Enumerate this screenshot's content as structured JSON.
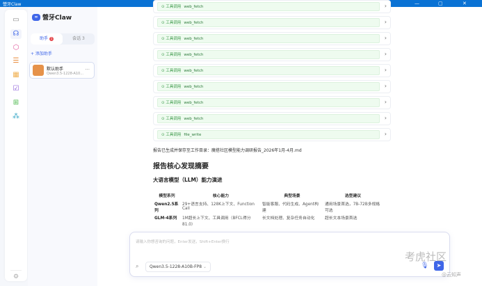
{
  "window": {
    "title": "營牙Claw",
    "minimize": "—",
    "maximize": "▢",
    "close": "✕"
  },
  "app": {
    "name": "營牙Claw",
    "logo": "∞"
  },
  "panel": {
    "tabs": [
      {
        "label": "助手",
        "badge": "1"
      },
      {
        "label": "会话",
        "badge": "3"
      }
    ],
    "add_label": "+ 添加助手",
    "agent": {
      "name": "默认助手",
      "model": "Qwen3.5-1228-A10...",
      "more": "···"
    }
  },
  "tools": [
    {
      "label": "工具调用",
      "name": "web_fetch"
    },
    {
      "label": "工具调用",
      "name": "web_fetch"
    },
    {
      "label": "工具调用",
      "name": "web_fetch"
    },
    {
      "label": "工具调用",
      "name": "web_fetch"
    },
    {
      "label": "工具调用",
      "name": "web_fetch"
    },
    {
      "label": "工具调用",
      "name": "web_fetch"
    },
    {
      "label": "工具调用",
      "name": "web_fetch"
    },
    {
      "label": "工具调用",
      "name": "web_fetch"
    },
    {
      "label": "工具调用",
      "name": "file_write"
    }
  ],
  "report": {
    "saved": "报告已生成并保存至工作目录：魔搭社区模型能力调研报告_2026年1月-4月.md",
    "h2": "报告核心发现摘要",
    "h3": "大语言模型（LLM）能力演进",
    "table": {
      "headers": [
        "模型系列",
        "核心能力",
        "典型场景",
        "选型建议"
      ],
      "rows": [
        [
          "Qwen2.5系列",
          "29+语言支持、128K上下文、Function Call",
          "智能客服、代码生成、Agent构建",
          "通用场景首选，7B-72B多规格可选"
        ],
        [
          "GLM-4系列",
          "1M超长上下文、工具调用（BFCL得分81.0）",
          "长文档处理、复杂任务自动化",
          "超长文本场景首选"
        ]
      ]
    }
  },
  "input": {
    "placeholder": "请输入你想咨询的问题，Enter发送，Shift+Enter换行",
    "model": "Qwen3.5-1228-A10B-FP8",
    "model_chevron": "⌄"
  },
  "watermark": {
    "main": "考虎社区",
    "sub": "@云知声"
  }
}
